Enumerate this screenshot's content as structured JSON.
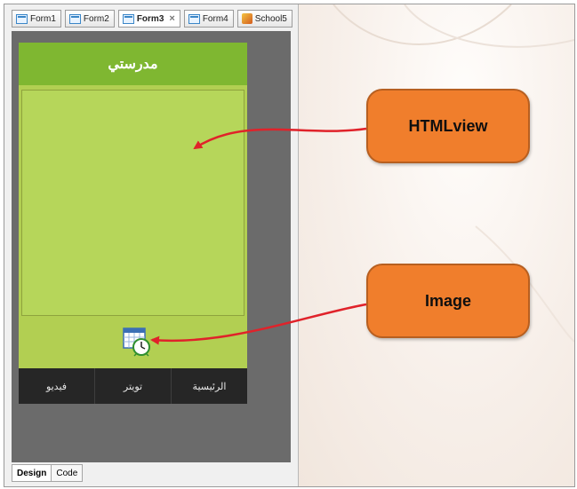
{
  "file_tabs": [
    {
      "label": "Form1",
      "icon": "form-icon",
      "active": false,
      "closable": false
    },
    {
      "label": "Form2",
      "icon": "form-icon",
      "active": false,
      "closable": false
    },
    {
      "label": "Form3",
      "icon": "form-icon",
      "active": true,
      "closable": true
    },
    {
      "label": "Form4",
      "icon": "form-icon",
      "active": false,
      "closable": false
    },
    {
      "label": "School5",
      "icon": "school-icon",
      "active": false,
      "closable": false
    }
  ],
  "close_glyph": "×",
  "phone": {
    "title": "مدرستي",
    "image_icon": "calendar-clock-icon",
    "nav_items": [
      "الرئيسية",
      "تويتر",
      "فيديو"
    ]
  },
  "bottom_tabs": [
    {
      "label": "Design",
      "active": true
    },
    {
      "label": "Code",
      "active": false
    }
  ],
  "callouts": {
    "htmlview": "HTMLview",
    "image": "Image"
  },
  "colors": {
    "title_bar": "#7fb731",
    "phone_bg": "#b2cf52",
    "callout": "#f07e2c",
    "arrow": "#e0222a",
    "nav_bar": "#262626"
  }
}
